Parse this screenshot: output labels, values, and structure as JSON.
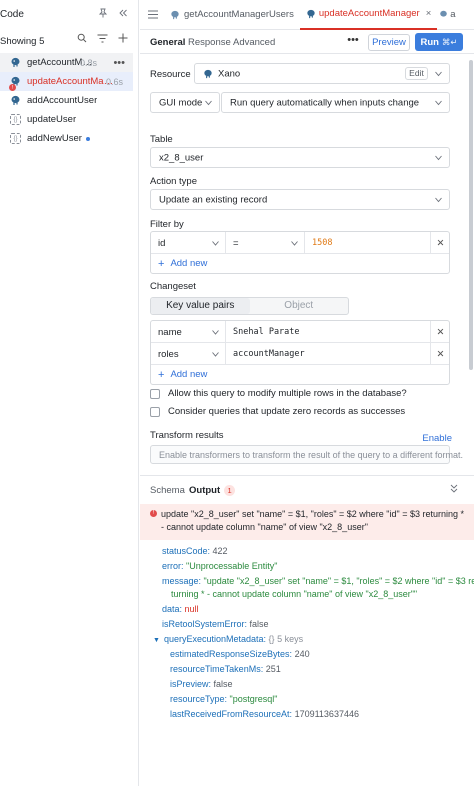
{
  "left": {
    "title": "Code",
    "showing": "Showing 5",
    "queries": [
      {
        "name": "getAccountM…",
        "time": "0.8s",
        "more": "•••",
        "state": "hover",
        "icon": "postgres-icon"
      },
      {
        "name": "updateAccountMa…",
        "time": "0.6s",
        "badge": "!",
        "state": "active",
        "icon": "postgres-icon"
      },
      {
        "name": "addAccountUser",
        "time": "",
        "state": "",
        "icon": "postgres-icon"
      },
      {
        "name": "updateUser",
        "time": "",
        "state": "",
        "icon": "js-icon"
      },
      {
        "name": "addNewUser",
        "time": "",
        "state": "",
        "icon": "js-icon",
        "dot": true
      }
    ]
  },
  "tabs": [
    {
      "label": "getAccountManagerUsers",
      "active": false
    },
    {
      "label": "updateAccountManager",
      "active": true
    },
    {
      "label": "a",
      "active": false
    }
  ],
  "subtabs": {
    "general": "General",
    "response": "Response",
    "advanced": "Advanced"
  },
  "toolbar": {
    "more": "•••",
    "preview": "Preview",
    "run": "Run",
    "run_kbd": "⌘↵"
  },
  "form": {
    "resource_label": "Resource",
    "resource_value": "Xano",
    "edit": "Edit",
    "mode_value": "GUI mode",
    "trigger_value": "Run query automatically when inputs change",
    "table_label": "Table",
    "table_value": "x2_8_user",
    "action_label": "Action type",
    "action_value": "Update an existing record",
    "filter_label": "Filter by",
    "filter": {
      "column": "id",
      "op": "=",
      "value": "1508"
    },
    "add_new": "Add new",
    "changeset_label": "Changeset",
    "seg_kv": "Key value pairs",
    "seg_obj": "Object",
    "changeset": [
      {
        "key": "name",
        "value": "Snehal Parate"
      },
      {
        "key": "roles",
        "value": "accountManager"
      }
    ],
    "add_new_2": "Add new",
    "check1": "Allow this query to modify multiple rows in the database?",
    "check2": "Consider queries that update zero records as successes",
    "transform_label": "Transform results",
    "enable": "Enable",
    "transform_placeholder": "Enable transformers to transform the result of the query to a different format."
  },
  "output": {
    "schema": "Schema",
    "output": "Output",
    "count": "1",
    "error_mark": "!",
    "error": "update \"x2_8_user\" set \"name\" = $1, \"roles\" = $2 where \"id\" = $3 returning * - cannot update column \"name\" of view \"x2_8_user\"",
    "statusCode_k": "statusCode:",
    "statusCode_v": "422",
    "error_k": "error:",
    "error_v": "\"Unprocessable Entity\"",
    "message_k": "message:",
    "message_v1": "\"update \"x2_8_user\" set \"name\" = $1, \"roles\" = $2 where \"id\" = $3 re",
    "message_v2": "turning * - cannot update column \"name\" of view \"x2_8_user\"\"",
    "data_k": "data:",
    "data_v": "null",
    "retool_k": "isRetoolSystemError:",
    "retool_v": "false",
    "qem_k": "queryExecutionMetadata:",
    "qem_brace": "{}",
    "qem_keys": "5 keys",
    "est_k": "estimatedResponseSizeBytes:",
    "est_v": "240",
    "time_k": "resourceTimeTakenMs:",
    "time_v": "251",
    "prev_k": "isPreview:",
    "prev_v": "false",
    "rtype_k": "resourceType:",
    "rtype_v": "\"postgresql\"",
    "last_k": "lastReceivedFromResourceAt:",
    "last_v": "1709113637446"
  },
  "colors": {
    "accent": "#3b7ddd",
    "error": "#d93025",
    "error_bg": "#fdecea"
  }
}
